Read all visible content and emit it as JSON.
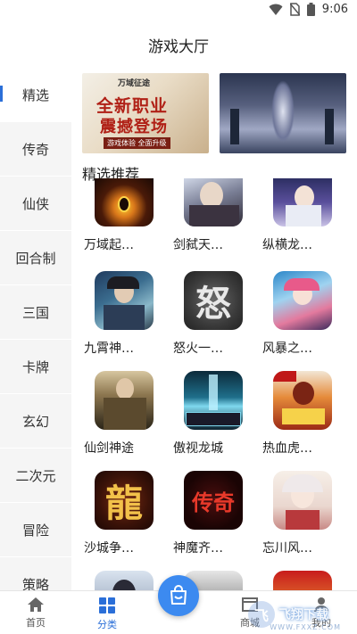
{
  "status_bar": {
    "time": "9:06"
  },
  "header": {
    "title": "游戏大厅"
  },
  "sidebar": {
    "items": [
      {
        "label": "精选"
      },
      {
        "label": "传奇"
      },
      {
        "label": "仙侠"
      },
      {
        "label": "回合制"
      },
      {
        "label": "三国"
      },
      {
        "label": "卡牌"
      },
      {
        "label": "玄幻"
      },
      {
        "label": "二次元"
      },
      {
        "label": "冒险"
      },
      {
        "label": "策略"
      }
    ],
    "active_index": 0
  },
  "banners": [
    {
      "brand": "万域征途",
      "line1": "全新职业",
      "line2": "震撼登场",
      "line3": "游戏体验 全面升级"
    },
    {
      "alt": ""
    }
  ],
  "section": {
    "title": "精选推荐"
  },
  "games": [
    {
      "name": "万域起…",
      "icon": "eye-emblem-icon",
      "glyph": ""
    },
    {
      "name": "剑弑天…",
      "icon": "swordsman-icon",
      "glyph": ""
    },
    {
      "name": "纵横龙…",
      "icon": "swordmaiden-icon",
      "glyph": ""
    },
    {
      "name": "九霄神…",
      "icon": "warrior-icon",
      "glyph": ""
    },
    {
      "name": "怒火一…",
      "icon": "stone-calligraphy-icon",
      "glyph": "怒"
    },
    {
      "name": "风暴之…",
      "icon": "anime-girl-icon",
      "glyph": ""
    },
    {
      "name": "仙剑神途",
      "icon": "armored-hero-icon",
      "glyph": ""
    },
    {
      "name": "傲视龙城",
      "icon": "ice-portal-icon",
      "glyph": ""
    },
    {
      "name": "热血虎…",
      "icon": "dragon-warrior-icon",
      "glyph": ""
    },
    {
      "name": "沙城争…",
      "icon": "dragon-calligraphy-icon",
      "glyph": "龍"
    },
    {
      "name": "神魔齐…",
      "icon": "legend-calligraphy-icon",
      "glyph": "传奇"
    },
    {
      "name": "忘川风…",
      "icon": "white-hair-girl-icon",
      "glyph": ""
    },
    {
      "name": "",
      "icon": "portrait-icon",
      "glyph": ""
    },
    {
      "name": "",
      "icon": "ink-icon",
      "glyph": ""
    },
    {
      "name": "",
      "icon": "gold-glyph-icon",
      "glyph": ""
    }
  ],
  "bottom_nav": {
    "items": [
      {
        "label": "首页",
        "icon": "home-icon"
      },
      {
        "label": "分类",
        "icon": "category-grid-icon"
      },
      {
        "label": "商城",
        "icon": "shop-icon"
      },
      {
        "label": "我的",
        "icon": "user-icon"
      }
    ],
    "active_index": 1,
    "center_button_icon": "shopping-bag-icon"
  },
  "watermark": {
    "text": "飞翔下载",
    "sub": "WWW.FXXZ.COM"
  },
  "colors": {
    "accent": "#2b6fd8",
    "fab": "#3c8af0",
    "sidebar_bg": "#f5f5f5"
  }
}
